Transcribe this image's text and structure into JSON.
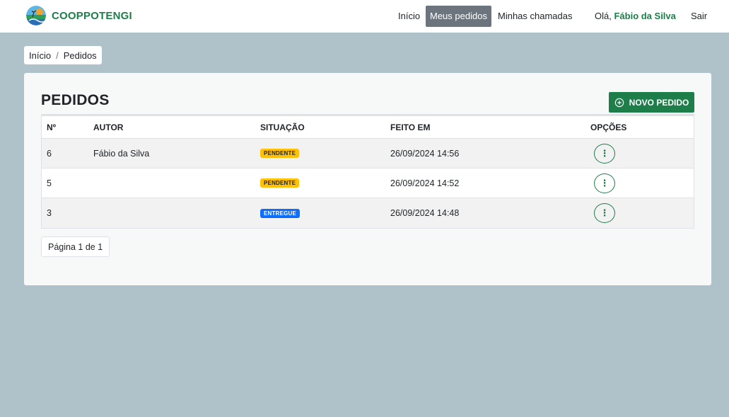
{
  "brand": {
    "name": "COOPPOTENGI"
  },
  "nav": {
    "items": [
      {
        "label": "Início",
        "active": false
      },
      {
        "label": "Meus pedidos",
        "active": true
      },
      {
        "label": "Minhas chamadas",
        "active": false
      }
    ],
    "greeting": "Olá,",
    "user_name": "Fábio da Silva",
    "logout": "Sair"
  },
  "breadcrumb": {
    "items": [
      "Início",
      "Pedidos"
    ],
    "separator": "/"
  },
  "page": {
    "title": "PEDIDOS",
    "new_button": "NOVO PEDIDO"
  },
  "table": {
    "headers": {
      "number": "Nº",
      "author": "AUTOR",
      "status": "SITUAÇÃO",
      "date": "FEITO EM",
      "options": "OPÇÕES"
    },
    "rows": [
      {
        "number": "6",
        "author": "Fábio da Silva",
        "status": "PENDENTE",
        "date": "26/09/2024 14:56",
        "options_icon": "⋮"
      },
      {
        "number": "5",
        "author": "",
        "status": "PENDENTE",
        "date": "26/09/2024 14:52",
        "options_icon": "⋮"
      },
      {
        "number": "3",
        "author": "",
        "status": "ENTREGUE",
        "date": "26/09/2024 14:48",
        "options_icon": "⋮"
      }
    ]
  },
  "pagination": {
    "label": "Página 1 de 1"
  },
  "colors": {
    "brand_green": "#1e7e4a",
    "background": "#afc1c9",
    "pending": "#ffc107",
    "delivered": "#0d6efd",
    "active_nav": "#6c757d"
  },
  "icons": {
    "logo": "cooperative-logo-icon",
    "add": "plus-circle-icon",
    "options": "vertical-ellipsis-icon"
  }
}
